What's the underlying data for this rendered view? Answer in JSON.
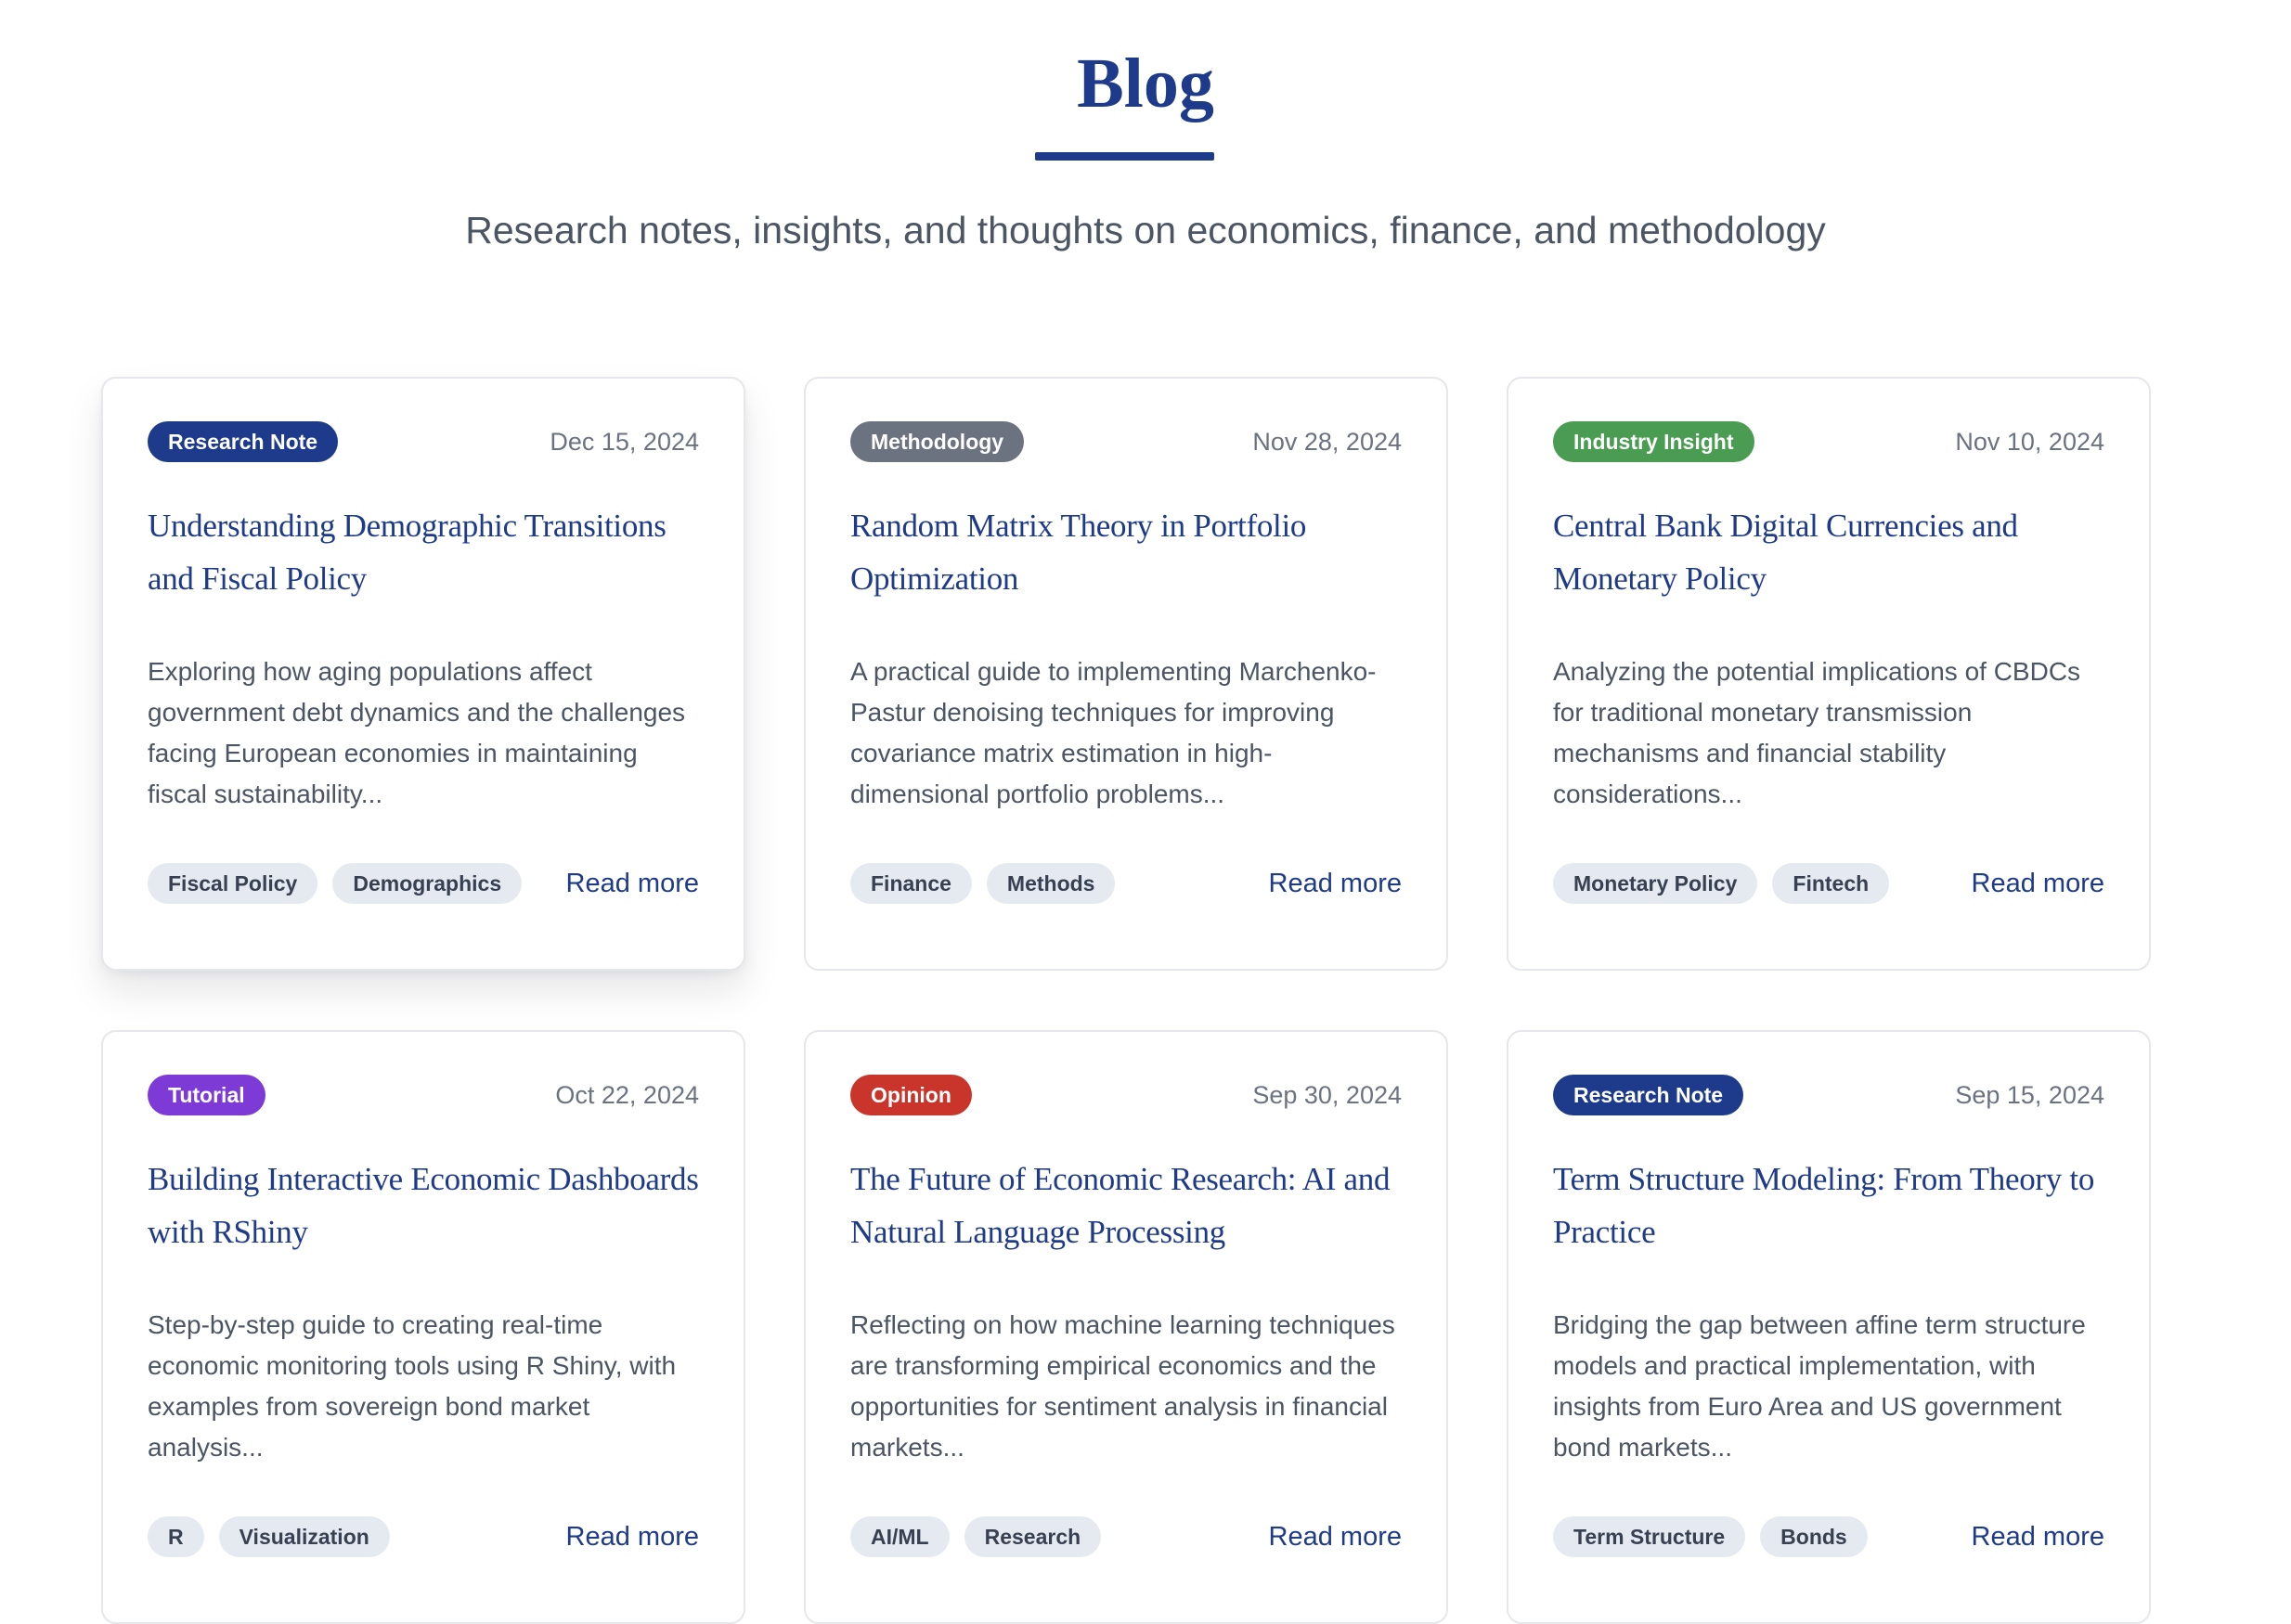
{
  "header": {
    "title": "Blog",
    "subtitle": "Research notes, insights, and thoughts on economics, finance, and methodology"
  },
  "colors": {
    "accent": "#1e3a8a",
    "research_note": "#1e3a8a",
    "methodology": "#6b7280",
    "industry_insight": "#4a9c52",
    "tutorial": "#7e3ad6",
    "opinion": "#c9342b",
    "tag_background": "#e5eaf1"
  },
  "posts": [
    {
      "category": "Research Note",
      "category_color": "#1e3a8a",
      "date": "Dec 15, 2024",
      "title": "Understanding Demographic Transitions and Fiscal Policy",
      "excerpt": "Exploring how aging populations affect government debt dynamics and the challenges facing European economies in maintaining fiscal sustainability...",
      "tags": [
        "Fiscal Policy",
        "Demographics"
      ],
      "read_more": "Read more"
    },
    {
      "category": "Methodology",
      "category_color": "#6b7280",
      "date": "Nov 28, 2024",
      "title": "Random Matrix Theory in Portfolio Optimization",
      "excerpt": "A practical guide to implementing Marchenko-Pastur denoising techniques for improving covariance matrix estimation in high-dimensional portfolio problems...",
      "tags": [
        "Finance",
        "Methods"
      ],
      "read_more": "Read more"
    },
    {
      "category": "Industry Insight",
      "category_color": "#4a9c52",
      "date": "Nov 10, 2024",
      "title": "Central Bank Digital Currencies and Monetary Policy",
      "excerpt": "Analyzing the potential implications of CBDCs for traditional monetary transmission mechanisms and financial stability considerations...",
      "tags": [
        "Monetary Policy",
        "Fintech"
      ],
      "read_more": "Read more"
    },
    {
      "category": "Tutorial",
      "category_color": "#7e3ad6",
      "date": "Oct 22, 2024",
      "title": "Building Interactive Economic Dashboards with RShiny",
      "excerpt": "Step-by-step guide to creating real-time economic monitoring tools using R Shiny, with examples from sovereign bond market analysis...",
      "tags": [
        "R",
        "Visualization"
      ],
      "read_more": "Read more"
    },
    {
      "category": "Opinion",
      "category_color": "#c9342b",
      "date": "Sep 30, 2024",
      "title": "The Future of Economic Research: AI and Natural Language Processing",
      "excerpt": "Reflecting on how machine learning techniques are transforming empirical economics and the opportunities for sentiment analysis in financial markets...",
      "tags": [
        "AI/ML",
        "Research"
      ],
      "read_more": "Read more"
    },
    {
      "category": "Research Note",
      "category_color": "#1e3a8a",
      "date": "Sep 15, 2024",
      "title": "Term Structure Modeling: From Theory to Practice",
      "excerpt": "Bridging the gap between affine term structure models and practical implementation, with insights from Euro Area and US government bond markets...",
      "tags": [
        "Term Structure",
        "Bonds"
      ],
      "read_more": "Read more"
    }
  ]
}
